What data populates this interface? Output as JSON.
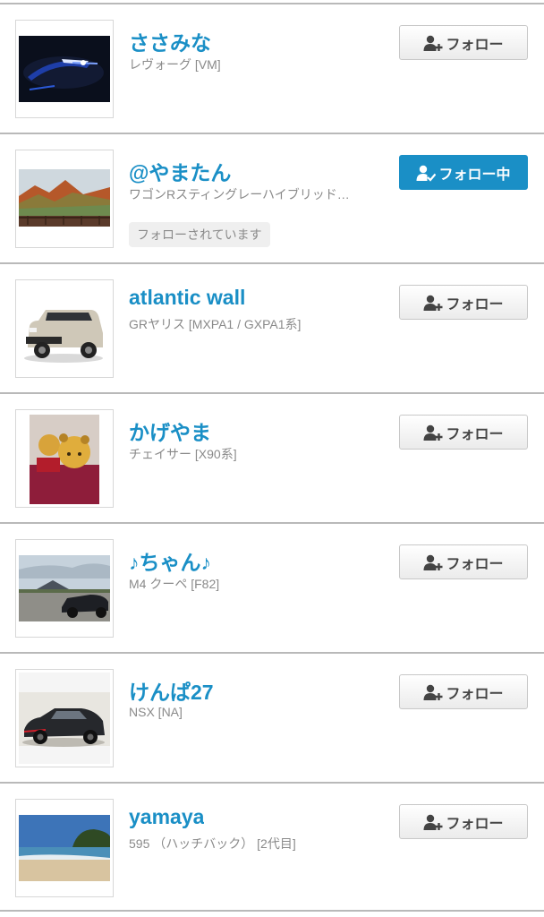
{
  "follow_list": [
    {
      "name": "ささみな",
      "car": "レヴォーグ [VM]",
      "follow_label": "フォロー",
      "following": false,
      "followed_by": ""
    },
    {
      "name": "@やまたん",
      "car": "ワゴンRスティングレーハイブリッド…",
      "follow_label": "フォロー中",
      "following": true,
      "followed_by": "フォローされています"
    },
    {
      "name": "atlantic wall",
      "car": "GRヤリス [MXPA1 / GXPA1系]",
      "follow_label": "フォロー",
      "following": false,
      "followed_by": ""
    },
    {
      "name": "かげやま",
      "car": "チェイサー [X90系]",
      "follow_label": "フォロー",
      "following": false,
      "followed_by": ""
    },
    {
      "name": "♪ちゃん♪",
      "car": "M4 クーペ [F82]",
      "follow_label": "フォロー",
      "following": false,
      "followed_by": ""
    },
    {
      "name": "けんぱ27",
      "car": "NSX [NA]",
      "follow_label": "フォロー",
      "following": false,
      "followed_by": ""
    },
    {
      "name": "yamaya",
      "car": "595 （ハッチバック） [2代目]",
      "follow_label": "フォロー",
      "following": false,
      "followed_by": ""
    }
  ],
  "icons": {
    "follow": "add-user-icon",
    "following": "user-check-icon"
  },
  "colors": {
    "accent": "#1a8fc6",
    "divider": "#b9b9b9",
    "secondary_text": "#8a8a8a"
  }
}
